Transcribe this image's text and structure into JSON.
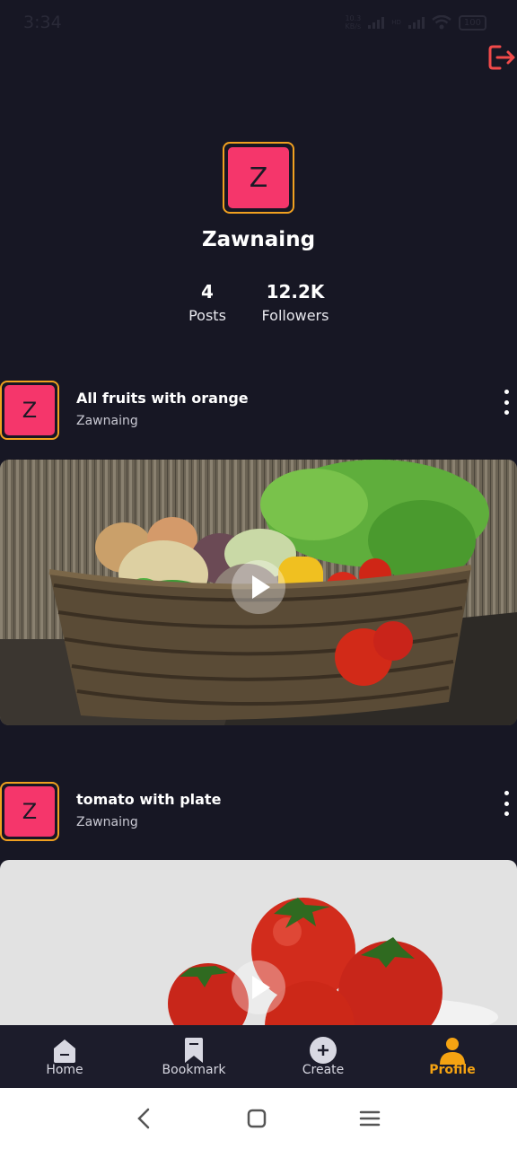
{
  "status_bar": {
    "time": "3:34",
    "net_speed_top": "10.3",
    "net_speed_bottom": "KB/s",
    "sim_label": "HD",
    "battery": "100"
  },
  "header": {
    "logout_icon": "logout-icon"
  },
  "profile": {
    "avatar_letter": "Z",
    "name": "Zawnaing",
    "stats": [
      {
        "value": "4",
        "label": "Posts"
      },
      {
        "value": "12.2K",
        "label": "Followers"
      }
    ]
  },
  "posts": [
    {
      "avatar_letter": "Z",
      "title": "All fruits with orange",
      "author": "Zawnaing",
      "image": "vegetable basket photo"
    },
    {
      "avatar_letter": "Z",
      "title": "tomato with plate",
      "author": "Zawnaing",
      "image": "tomatoes on plate photo"
    }
  ],
  "bottom_nav": [
    {
      "label": "Home",
      "icon": "home-icon",
      "active": false
    },
    {
      "label": "Bookmark",
      "icon": "bookmark-icon",
      "active": false
    },
    {
      "label": "Create",
      "icon": "create-icon",
      "active": false
    },
    {
      "label": "Profile",
      "icon": "profile-icon",
      "active": true
    }
  ],
  "colors": {
    "background": "#171724",
    "accent": "#f5a312",
    "avatar": "#f5366b",
    "logout": "#f04a4a"
  }
}
